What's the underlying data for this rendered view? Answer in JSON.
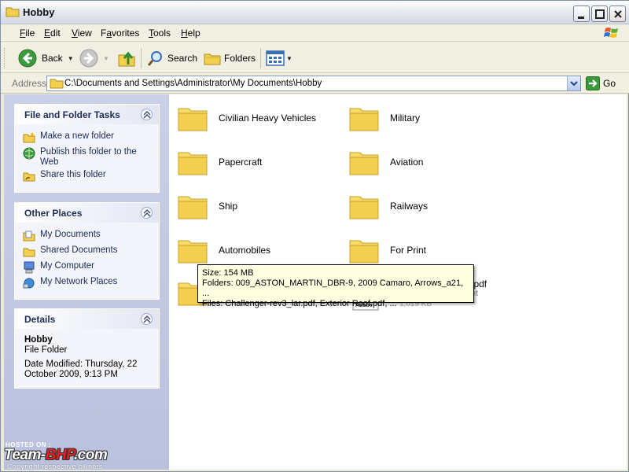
{
  "window": {
    "title": "Hobby"
  },
  "menu": [
    {
      "label": "File",
      "key": "F",
      "rest": "ile"
    },
    {
      "label": "Edit",
      "key": "E",
      "rest": "dit"
    },
    {
      "label": "View",
      "key": "V",
      "rest": "iew"
    },
    {
      "label": "Favorites",
      "key": "a",
      "pre": "F",
      "rest": "vorites"
    },
    {
      "label": "Tools",
      "key": "T",
      "rest": "ools"
    },
    {
      "label": "Help",
      "key": "H",
      "rest": "elp"
    }
  ],
  "toolbar": {
    "back_label": "Back",
    "search_label": "Search",
    "folders_label": "Folders"
  },
  "address": {
    "label": "Address",
    "value": "C:\\Documents and Settings\\Administrator\\My Documents\\Hobby",
    "go_label": "Go"
  },
  "tasks_panel": {
    "title": "File and Folder Tasks",
    "items": [
      "Make a new folder",
      "Publish this folder to the Web",
      "Share this folder"
    ]
  },
  "places_panel": {
    "title": "Other Places",
    "items": [
      "My Documents",
      "Shared Documents",
      "My Computer",
      "My Network Places"
    ]
  },
  "details_panel": {
    "title": "Details",
    "name": "Hobby",
    "type": "File Folder",
    "modified": "Date Modified: Thursday, 22 October 2009, 9:13 PM"
  },
  "folders": [
    "Civilian Heavy Vehicles",
    "Military",
    "Papercraft",
    "Aviation",
    "Ship",
    "Railways",
    "Automobiles",
    "For Print"
  ],
  "pdf_file": {
    "name_visible": "v.pdf",
    "sub_visible": "nt",
    "size_visible": "1,019 KB",
    "logo_text": "Adobe"
  },
  "tooltip": {
    "size": "Size: 154 MB",
    "folders": "Folders: 009_ASTON_MARTIN_DBR-9, 2009 Camaro, Arrows_a21, ...",
    "files": "Files: Challenger-rev3_lar.pdf, Exterior Roof.pdf, ..."
  },
  "watermark": {
    "hosted": "HOSTED ON :",
    "brand_a": "Team-",
    "brand_b": "BHP",
    "brand_c": ".com",
    "copyright": "Copyright respective owners"
  },
  "colors": {
    "task_pane": "#c1c9e4",
    "folder_yellow": "#f6d456",
    "tooltip_bg": "#ffffe1"
  }
}
